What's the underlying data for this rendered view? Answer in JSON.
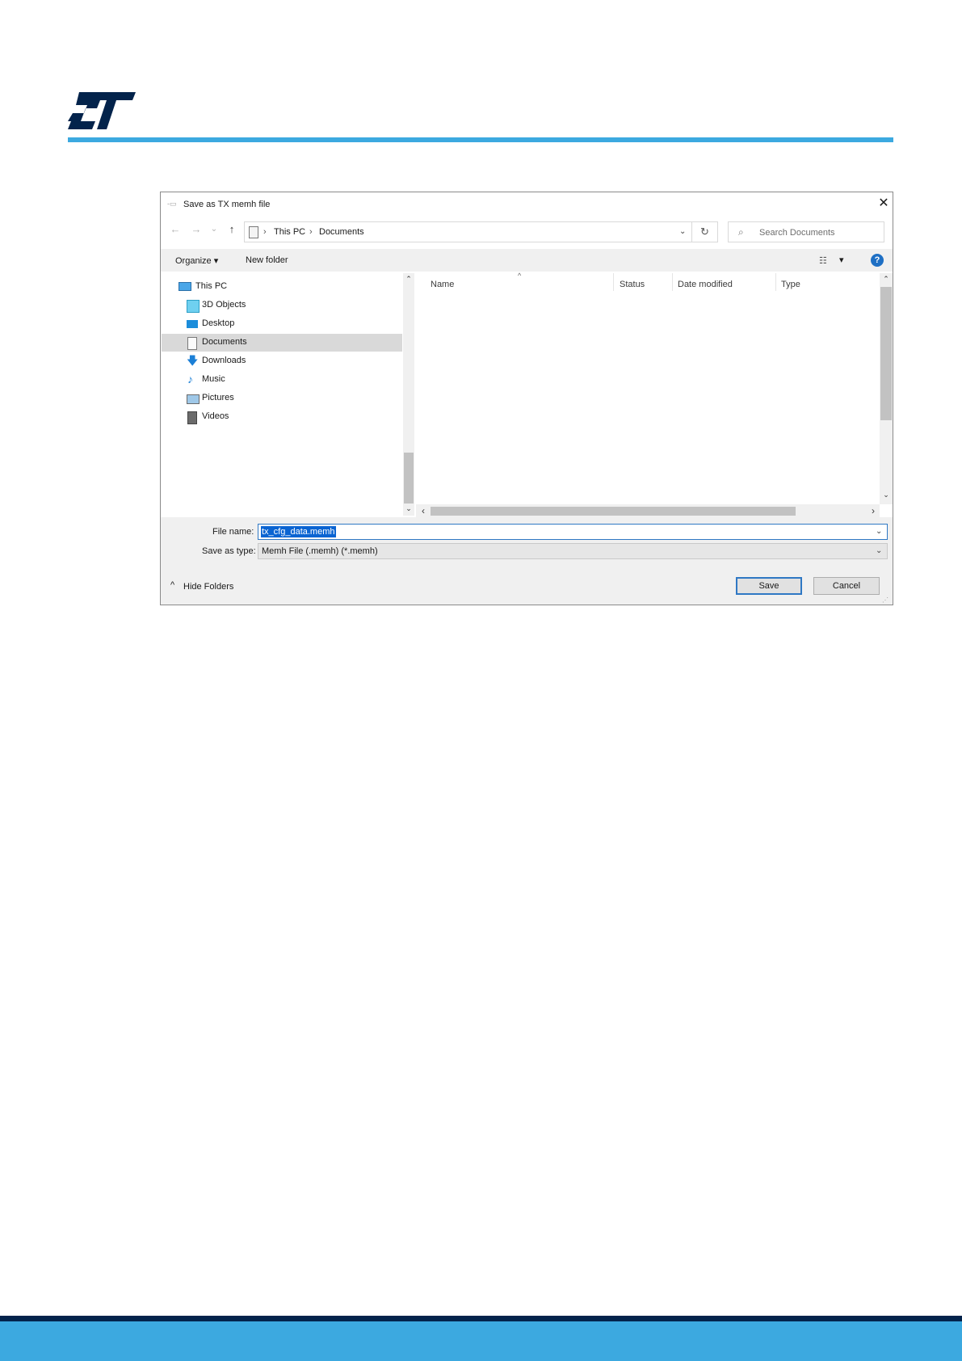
{
  "dialog": {
    "title": "Save as TX memh file",
    "close_glyph": "✕",
    "nav": {
      "back": "←",
      "forward": "→",
      "recent": "⌄",
      "up": "↑"
    },
    "address": {
      "crumbs": [
        "This PC",
        "Documents"
      ],
      "separator": "›",
      "dropdown": "⌄",
      "refresh": "↻"
    },
    "search_placeholder": "Search Documents",
    "toolbar": {
      "organize": "Organize ▾",
      "new_folder": "New folder",
      "view_menu": "▾",
      "help": "?"
    },
    "tree": [
      {
        "label": "This PC",
        "icon": "computer-icon"
      },
      {
        "label": "3D Objects",
        "icon": "cube-icon"
      },
      {
        "label": "Desktop",
        "icon": "desktop-icon"
      },
      {
        "label": "Documents",
        "icon": "document-icon",
        "selected": true
      },
      {
        "label": "Downloads",
        "icon": "download-icon"
      },
      {
        "label": "Music",
        "icon": "music-icon"
      },
      {
        "label": "Pictures",
        "icon": "picture-icon"
      },
      {
        "label": "Videos",
        "icon": "video-icon"
      }
    ],
    "columns": [
      "Name",
      "Status",
      "Date modified",
      "Type"
    ],
    "sort_indicator": "^",
    "scroll_glyphs": {
      "up": "⌃",
      "down": "⌄",
      "left": "‹",
      "right": "›"
    },
    "file_name_label": "File name:",
    "file_name_value": "tx_cfg_data.memh",
    "save_type_label": "Save as type:",
    "save_type_value": "Memh File (.memh)  (*.memh)",
    "save_button": "Save",
    "cancel_button": "Cancel",
    "hide_folders": "Hide Folders",
    "hide_chevron": "^"
  },
  "colors": {
    "brand_dark": "#03234b",
    "brand_light": "#3ca9e0",
    "selection": "#0a64d2"
  }
}
